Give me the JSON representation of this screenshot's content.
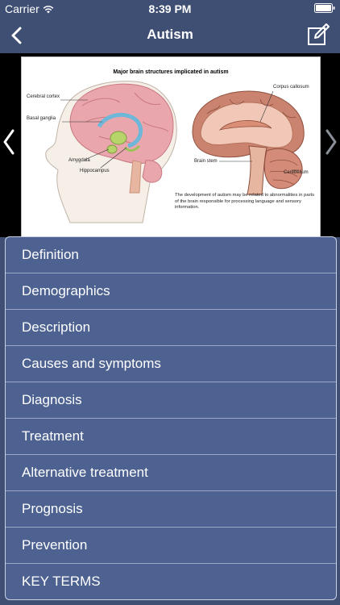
{
  "status": {
    "carrier": "Carrier",
    "time": "8:39 PM"
  },
  "nav": {
    "title": "Autism"
  },
  "figure": {
    "title": "Major brain structures implicated in autism",
    "labels": {
      "cerebral_cortex": "Cerebral cortex",
      "basal_ganglia": "Basal ganglia",
      "amygdala": "Amygdala",
      "hippocampus": "Hippocampus",
      "corpus_callosum": "Corpus callosum",
      "brain_stem": "Brain stem",
      "cerebellum": "Cerebellum"
    },
    "caption": "The development of autism may be related to abnormalities in parts of the brain responsible for processing language and sensory information."
  },
  "menu": {
    "items": [
      "Definition",
      "Demographics",
      "Description",
      "Causes and symptoms",
      "Diagnosis",
      "Treatment",
      "Alternative treatment",
      "Prognosis",
      "Prevention",
      "KEY TERMS"
    ]
  },
  "colors": {
    "background": "#3f4f73",
    "menu": "#4e6291",
    "accent": "#ffffff"
  },
  "icons": [
    "wifi-icon",
    "battery-icon",
    "back-icon",
    "edit-icon",
    "chevron-left-icon",
    "chevron-right-icon"
  ]
}
